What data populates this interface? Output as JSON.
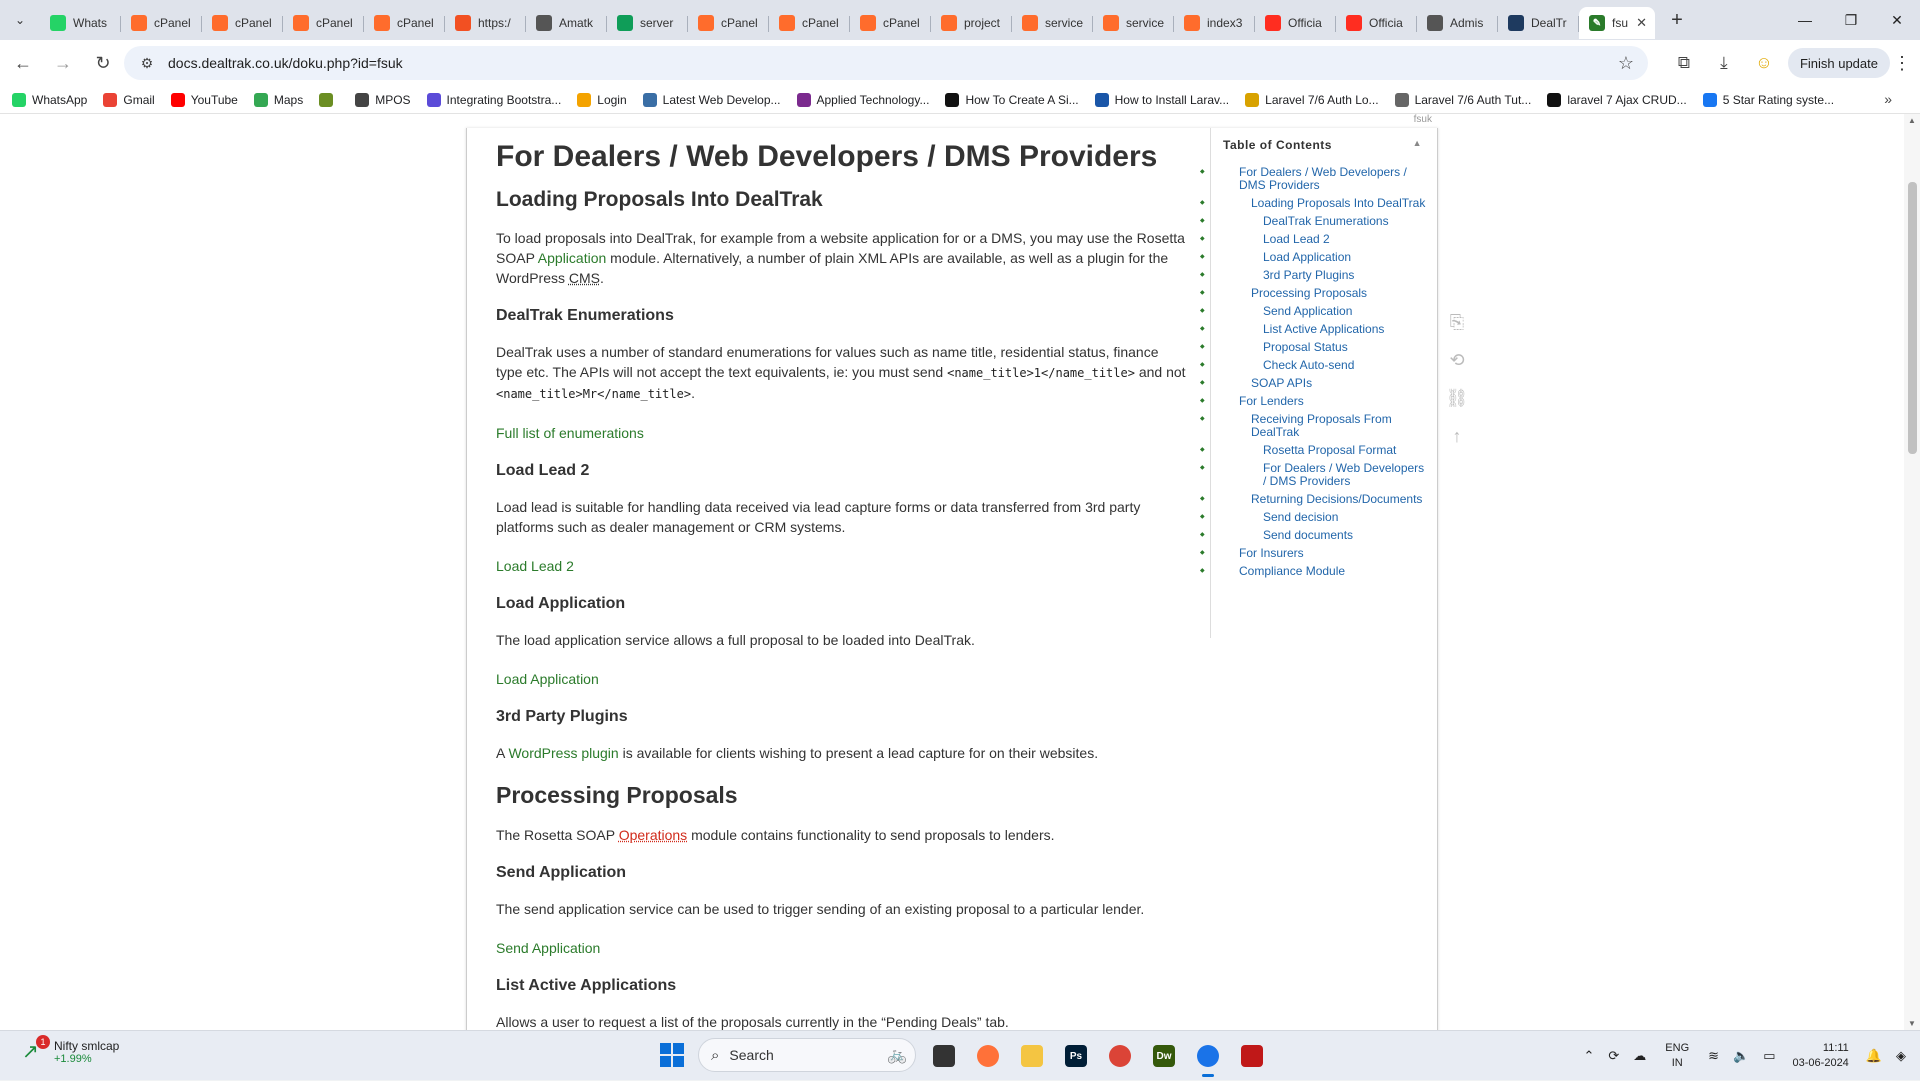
{
  "browser": {
    "tabs": [
      {
        "label": "Whats",
        "icon": "whatsapp-icon",
        "color": "#25d366"
      },
      {
        "label": "cPanel",
        "icon": "cpanel-icon",
        "color": "#ff6c2c"
      },
      {
        "label": "cPanel",
        "icon": "cpanel-icon",
        "color": "#ff6c2c"
      },
      {
        "label": "cPanel",
        "icon": "cpanel-icon",
        "color": "#ff6c2c"
      },
      {
        "label": "cPanel",
        "icon": "cpanel-icon",
        "color": "#ff6c2c"
      },
      {
        "label": "https:/",
        "icon": "blocked-site-icon",
        "color": "#f25022"
      },
      {
        "label": "Amatk",
        "icon": "amatk-icon",
        "color": "#555555"
      },
      {
        "label": "server",
        "icon": "sheets-icon",
        "color": "#0f9d58"
      },
      {
        "label": "cPanel",
        "icon": "cpanel-icon",
        "color": "#ff6c2c"
      },
      {
        "label": "cPanel",
        "icon": "cpanel-icon",
        "color": "#ff6c2c"
      },
      {
        "label": "cPanel",
        "icon": "cpanel-icon",
        "color": "#ff6c2c"
      },
      {
        "label": "project",
        "icon": "cpanel-icon",
        "color": "#ff6c2c"
      },
      {
        "label": "service",
        "icon": "cpanel-icon",
        "color": "#ff6c2c"
      },
      {
        "label": "service",
        "icon": "cpanel-icon",
        "color": "#ff6c2c"
      },
      {
        "label": "index3",
        "icon": "cpanel-icon",
        "color": "#ff6c2c"
      },
      {
        "label": "Officia",
        "icon": "laravel-icon",
        "color": "#ff2d20"
      },
      {
        "label": "Officia",
        "icon": "laravel-icon",
        "color": "#ff2d20"
      },
      {
        "label": "Admis",
        "icon": "admin-icon",
        "color": "#555555"
      },
      {
        "label": "DealTr",
        "icon": "dealtrak-icon",
        "color": "#1e3a5f"
      }
    ],
    "active_tab": {
      "label": "fsu",
      "icon": "dokuwiki-icon"
    },
    "url": "docs.dealtrak.co.uk/doku.php?id=fsuk",
    "finish_update_label": "Finish update",
    "bookmarks": [
      {
        "label": "WhatsApp",
        "color": "#25d366"
      },
      {
        "label": "Gmail",
        "color": "#ea4335"
      },
      {
        "label": "YouTube",
        "color": "#ff0000"
      },
      {
        "label": "Maps",
        "color": "#34a853"
      },
      {
        "label": "",
        "color": "#6b8e23"
      },
      {
        "label": "MPOS",
        "color": "#444444"
      },
      {
        "label": "Integrating Bootstra...",
        "color": "#5b4bd8"
      },
      {
        "label": "Login",
        "color": "#f4a300"
      },
      {
        "label": "Latest Web Develop...",
        "color": "#3a6ea5"
      },
      {
        "label": "Applied Technology...",
        "color": "#7b2a8e"
      },
      {
        "label": "How To Create A Si...",
        "color": "#111111"
      },
      {
        "label": "How to Install Larav...",
        "color": "#1a56a8"
      },
      {
        "label": "Laravel 7/6 Auth Lo...",
        "color": "#d8a200"
      },
      {
        "label": "Laravel 7/6 Auth Tut...",
        "color": "#666666"
      },
      {
        "label": "laravel 7 Ajax CRUD...",
        "color": "#111111"
      },
      {
        "label": "5 Star Rating syste...",
        "color": "#1877f2"
      }
    ]
  },
  "page": {
    "h1": "For Dealers / Web Developers / DMS Providers",
    "s1_title": "Loading Proposals Into DealTrak",
    "s1_p1": "To load proposals into DealTrak, for example from a website application for or a DMS, you may use the Rosetta SOAP ",
    "s1_p1_link": "Application",
    "s1_p1_b": " module. Alternatively, a number of plain XML APIs are available, as well as a plugin for the WordPress ",
    "s1_p1_abbr": "CMS",
    "s1_p1_end": ".",
    "enum_title": "DealTrak Enumerations",
    "enum_p1": "DealTrak uses a number of standard enumerations for values such as name title, residential status, finance type etc. The APIs will not accept the text equivalents, ie: you must send ",
    "enum_code1": "<name_title>1</name_title>",
    "enum_p1_mid": " and not ",
    "enum_code2": "<name_title>Mr</name_title>",
    "enum_p1_end": ".",
    "enum_link": "Full list of enumerations",
    "lead_title": "Load Lead 2",
    "lead_p": "Load lead is suitable for handling data received via lead capture forms or data transferred from 3rd party platforms such as dealer management or CRM systems.",
    "lead_link": "Load Lead 2",
    "app_title": "Load Application",
    "app_p": "The load application service allows a full proposal to be loaded into DealTrak.",
    "app_link": "Load Application",
    "plug_title": "3rd Party Plugins",
    "plug_p_a": "A ",
    "plug_link": "WordPress plugin",
    "plug_p_b": " is available for clients wishing to present a lead capture for on their websites.",
    "proc_title": "Processing Proposals",
    "proc_p_a": "The Rosetta SOAP ",
    "proc_link": "Operations",
    "proc_p_b": " module contains functionality to send proposals to lenders.",
    "send_title": "Send Application",
    "send_p": "The send application service can be used to trigger sending of an existing proposal to a particular lender.",
    "send_link": "Send Application",
    "list_title": "List Active Applications",
    "list_p": "Allows a user to request a list of the proposals currently in the “Pending Deals” tab."
  },
  "toc": {
    "page_tag": "fsuk",
    "heading": "Table of Contents",
    "items": [
      {
        "label": "For Dealers / Web Developers / DMS Providers",
        "level": 1
      },
      {
        "label": "Loading Proposals Into DealTrak",
        "level": 2
      },
      {
        "label": "DealTrak Enumerations",
        "level": 3
      },
      {
        "label": "Load Lead 2",
        "level": 3
      },
      {
        "label": "Load Application",
        "level": 3
      },
      {
        "label": "3rd Party Plugins",
        "level": 3
      },
      {
        "label": "Processing Proposals",
        "level": 2
      },
      {
        "label": "Send Application",
        "level": 3
      },
      {
        "label": "List Active Applications",
        "level": 3
      },
      {
        "label": "Proposal Status",
        "level": 3
      },
      {
        "label": "Check Auto-send",
        "level": 3
      },
      {
        "label": "SOAP APIs",
        "level": 2
      },
      {
        "label": "For Lenders",
        "level": 1
      },
      {
        "label": "Receiving Proposals From DealTrak",
        "level": 2
      },
      {
        "label": "Rosetta Proposal Format",
        "level": 3
      },
      {
        "label": "For Dealers / Web Developers / DMS Providers",
        "level": 3
      },
      {
        "label": "Returning Decisions/Documents",
        "level": 2
      },
      {
        "label": "Send decision",
        "level": 3
      },
      {
        "label": "Send documents",
        "level": 3
      },
      {
        "label": "For Insurers",
        "level": 1
      },
      {
        "label": "Compliance Module",
        "level": 1
      }
    ]
  },
  "taskbar": {
    "widget_title": "Nifty smlcap",
    "widget_value": "+1.99%",
    "widget_badge": "1",
    "search_label": "Search",
    "lang_top": "ENG",
    "lang_bottom": "IN",
    "time": "11:11",
    "date": "03-06-2024",
    "apps": [
      {
        "name": "file-explorer-icon",
        "color": "#333333",
        "glyph": ""
      },
      {
        "name": "firefox-icon",
        "color": "#ff7139",
        "glyph": ""
      },
      {
        "name": "folder-icon",
        "color": "#f4c542",
        "glyph": ""
      },
      {
        "name": "photoshop-icon",
        "color": "#001e36",
        "glyph": "Ps"
      },
      {
        "name": "chrome-icon",
        "color": "#db4437",
        "glyph": ""
      },
      {
        "name": "dreamweaver-icon",
        "color": "#35590b",
        "glyph": "Dw"
      },
      {
        "name": "chrome-active-icon",
        "color": "#1a73e8",
        "glyph": ""
      },
      {
        "name": "mcafee-icon",
        "color": "#c01818",
        "glyph": ""
      }
    ]
  }
}
